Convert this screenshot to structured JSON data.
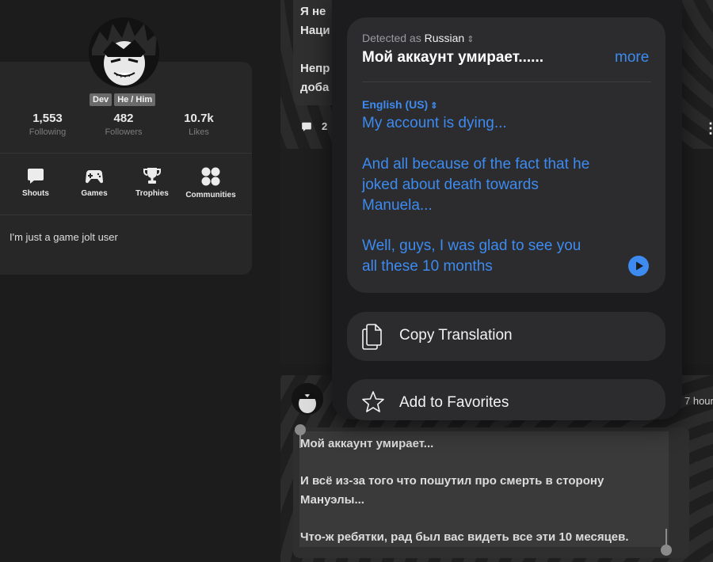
{
  "profile": {
    "badges": [
      "Dev",
      "He / Him"
    ],
    "stats": [
      {
        "value": "1,553",
        "label": "Following"
      },
      {
        "value": "482",
        "label": "Followers"
      },
      {
        "value": "10.7k",
        "label": "Likes"
      }
    ],
    "nav": [
      {
        "label": "Shouts",
        "icon": "shouts-icon"
      },
      {
        "label": "Games",
        "icon": "gamepad-icon"
      },
      {
        "label": "Trophies",
        "icon": "trophy-icon"
      },
      {
        "label": "Communities",
        "icon": "communities-icon"
      }
    ],
    "bio": "I'm just a game jolt user"
  },
  "feed": {
    "top_post": {
      "lines": [
        "Я не",
        "Наци",
        "Непр",
        "доба"
      ],
      "comment_count": "2"
    },
    "bottom_post": {
      "time": "7 hour",
      "lines": [
        "Мой аккаунт умирает...",
        "И всё из-за того что пошутил про смерть в сторону",
        "Мануэлы...",
        "Что-ж ребятки, рад был вас видеть все эти 10 месяцев."
      ]
    }
  },
  "translate": {
    "detected_prefix": "Detected as",
    "detected_language": "Russian",
    "source_text": "Мой аккаунт умирает......",
    "more_label": "more",
    "target_language": "English (US)",
    "translation_lines": [
      "My account is dying...",
      "And all because of the fact that he",
      "joked about death towards",
      "Manuela...",
      "Well, guys, I was glad to see you",
      "all these 10 months"
    ],
    "actions": [
      {
        "label": "Copy Translation",
        "icon": "copy-icon"
      },
      {
        "label": "Add to Favorites",
        "icon": "star-icon"
      }
    ],
    "accent_color": "#3d8bf0"
  }
}
